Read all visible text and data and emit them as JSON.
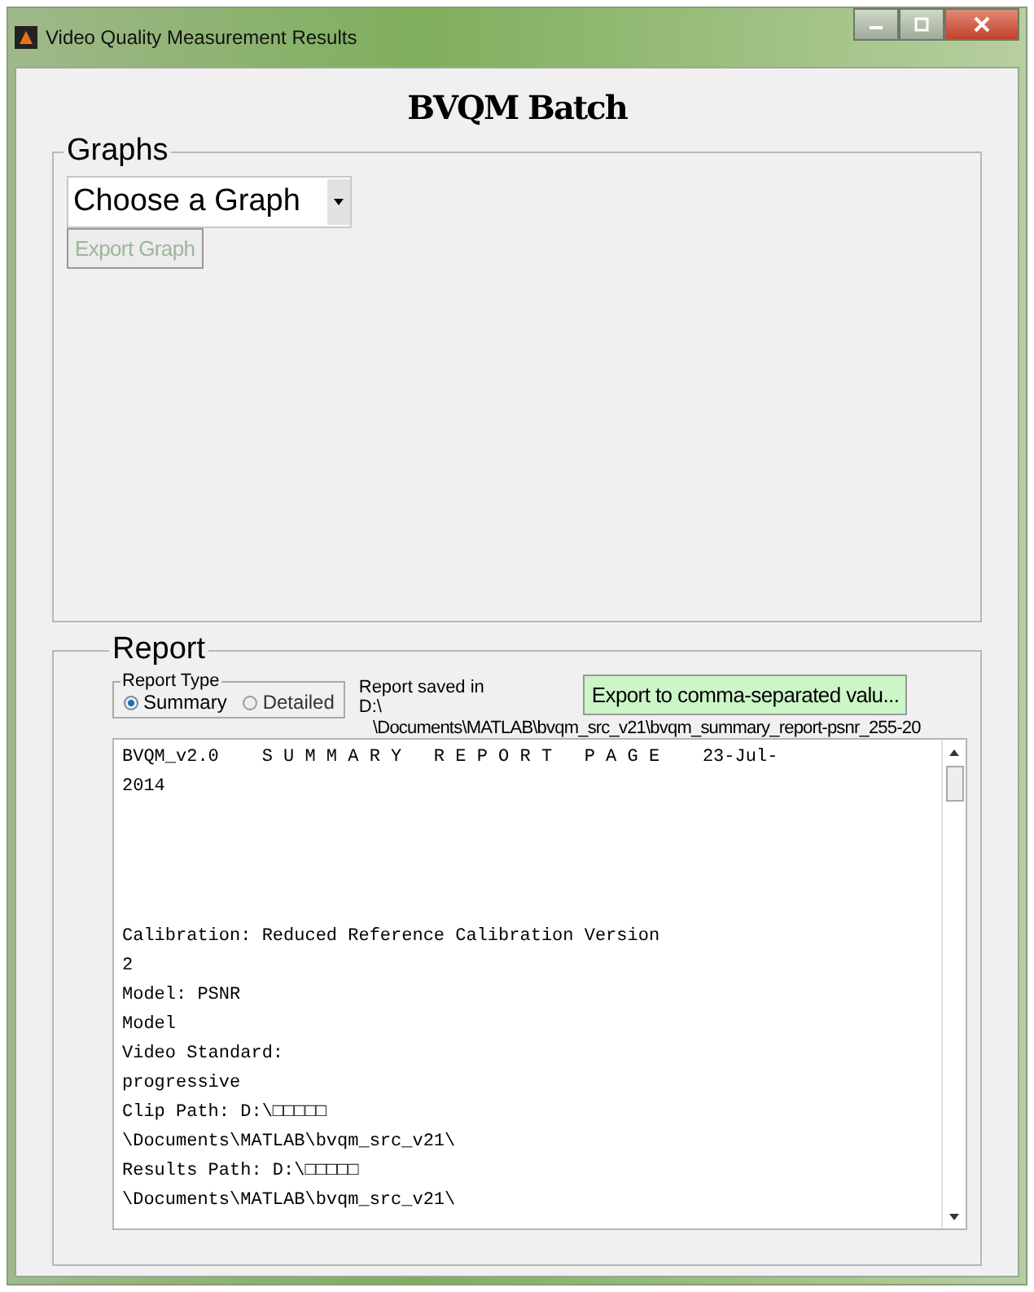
{
  "window": {
    "title": "Video Quality Measurement Results"
  },
  "heading": "BVQM Batch",
  "graphs": {
    "title": "Graphs",
    "dropdown": {
      "value": "Choose a Graph"
    },
    "export_button": {
      "label": "Export Graph",
      "disabled": true
    }
  },
  "report": {
    "title": "Report",
    "report_type": {
      "title": "Report Type",
      "options": [
        {
          "label": "Summary",
          "selected": true
        },
        {
          "label": "Detailed",
          "selected": false
        }
      ]
    },
    "saved_label": "Report saved in",
    "saved_drive": "D:\\",
    "saved_path": "\\Documents\\MATLAB\\bvqm_src_v21\\bvqm_summary_report-psnr_255-20",
    "export_button": {
      "label": "Export to comma-separated valu...",
      "disabled": false
    },
    "header_lines": [
      "BVQM_v2.0    S U M M A R Y   R E P O R T   P A G E    23-Jul-",
      "2014"
    ],
    "body_lines": [
      "Calibration: Reduced Reference Calibration Version",
      "2",
      "Model: PSNR",
      "Model",
      "Video Standard:",
      "progressive",
      "Clip Path: D:\\□□□□□",
      "\\Documents\\MATLAB\\bvqm_src_v21\\",
      "Results Path: D:\\□□□□□",
      "\\Documents\\MATLAB\\bvqm_src_v21\\"
    ]
  }
}
